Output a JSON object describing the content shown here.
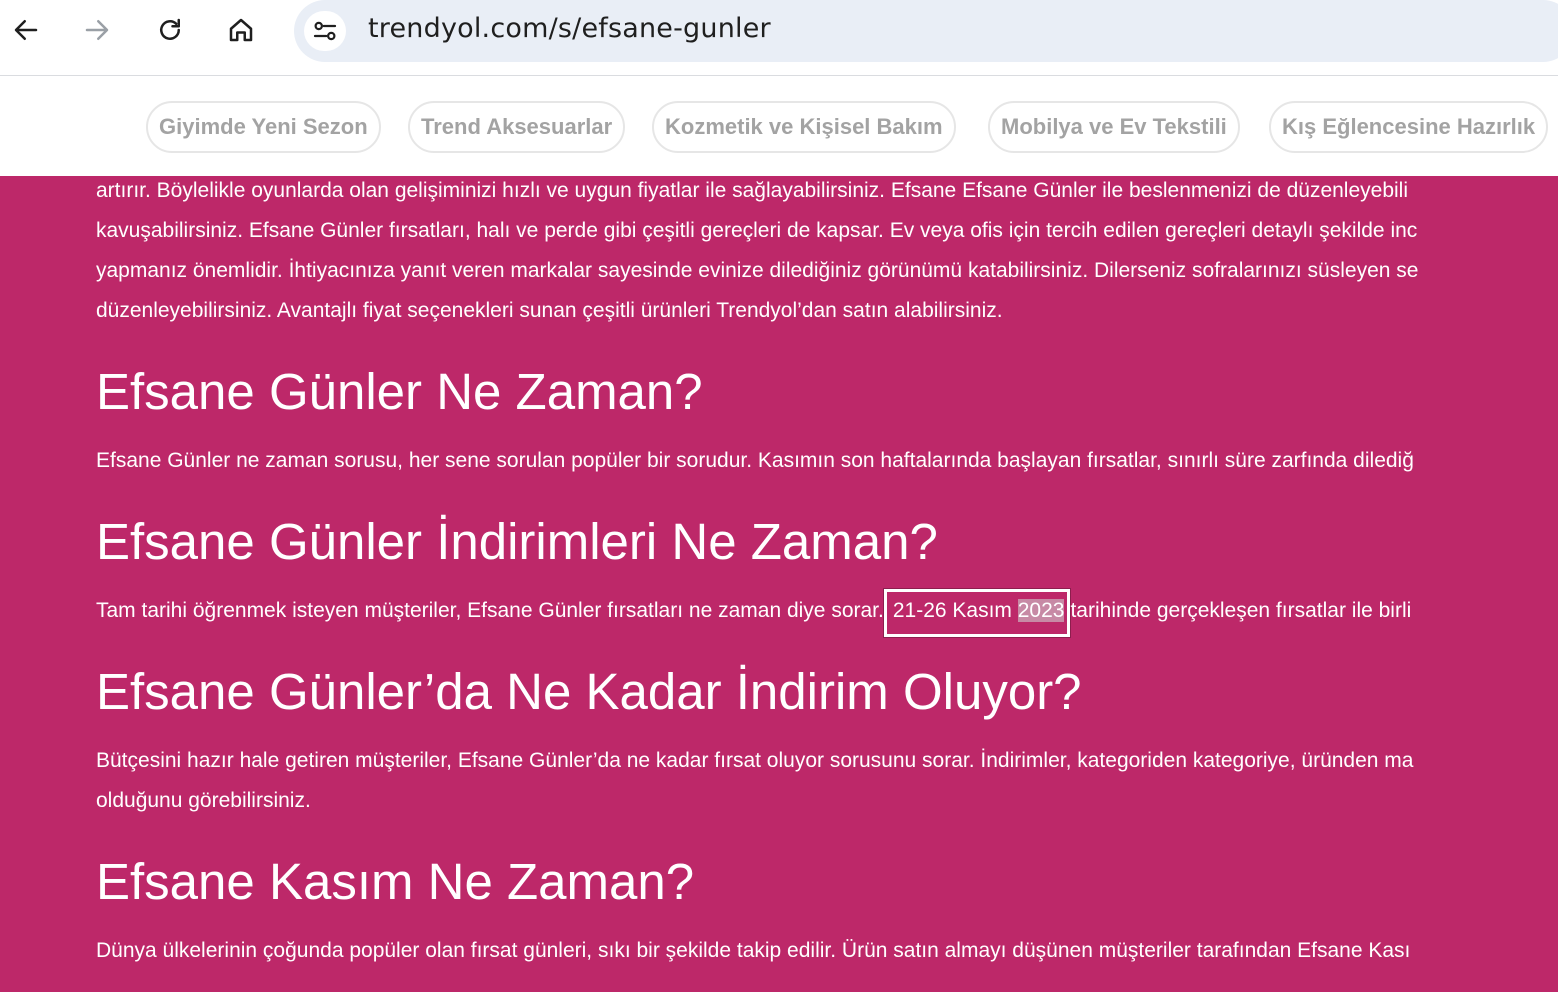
{
  "browser": {
    "url": "trendyol.com/s/efsane-gunler"
  },
  "chips": [
    {
      "label": "Giyimde Yeni Sezon"
    },
    {
      "label": "Trend Aksesuarlar"
    },
    {
      "label": "Kozmetik ve Kişisel Bakım"
    },
    {
      "label": "Mobilya ve Ev Tekstili"
    },
    {
      "label": "Kış Eğlencesine Hazırlık"
    }
  ],
  "content": {
    "intro_lines": [
      "artırır. Böylelikle oyunlarda olan gelişiminizi hızlı ve uygun fiyatlar ile sağlayabilirsiniz. Efsane Efsane Günler ile beslenmenizi de düzenleyebili",
      "kavuşabilirsiniz. Efsane Günler fırsatları, halı ve perde gibi çeşitli gereçleri de kapsar. Ev veya ofis için tercih edilen gereçleri detaylı şekilde inc",
      "yapmanız önemlidir. İhtiyacınıza yanıt veren markalar sayesinde evinize dilediğiniz görünümü katabilirsiniz. Dilerseniz sofralarınızı süsleyen se",
      "düzenleyebilirsiniz. Avantajlı fiyat seçenekleri sunan çeşitli ürünleri Trendyol’dan satın alabilirsiniz."
    ],
    "section1": {
      "heading": "Efsane Günler Ne Zaman?",
      "text": "Efsane Günler ne zaman sorusu, her sene sorulan popüler bir sorudur. Kasımın son haftalarında başlayan fırsatlar, sınırlı süre zarfında dilediğ"
    },
    "section2": {
      "heading": "Efsane Günler İndirimleri Ne Zaman?",
      "text_before": "Tam tarihi öğrenmek isteyen müşteriler, Efsane Günler fırsatları ne zaman diye sorar.",
      "date_days": "21-26 Kasım",
      "date_year": "2023",
      "text_after": "tarihinde gerçekleşen fırsatlar ile birli"
    },
    "section3": {
      "heading": "Efsane Günler’da Ne Kadar İndirim Oluyor?",
      "lines": [
        "Bütçesini hazır hale getiren müşteriler, Efsane Günler’da ne kadar fırsat oluyor sorusunu sorar. İndirimler, kategoriden kategoriye, üründen ma",
        "olduğunu görebilirsiniz."
      ]
    },
    "section4": {
      "heading": "Efsane Kasım Ne Zaman?",
      "text": "Dünya ülkelerinin çoğunda popüler olan fırsat günleri, sıkı bir şekilde takip edilir. Ürün satın almayı düşünen müşteriler tarafından Efsane Kası"
    }
  },
  "colors": {
    "content_background": "#bd2869",
    "chip_text": "#a3a3a3",
    "omnibox": "#e9eef6"
  }
}
